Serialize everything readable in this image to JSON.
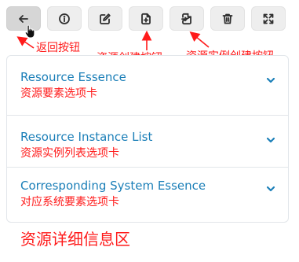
{
  "toolbar": {
    "buttons": [
      {
        "id": "back",
        "icon": "arrow-left-icon"
      },
      {
        "id": "info",
        "icon": "info-icon"
      },
      {
        "id": "edit",
        "icon": "edit-icon"
      },
      {
        "id": "new-resource",
        "icon": "file-plus-icon"
      },
      {
        "id": "new-instance",
        "icon": "file-import-icon"
      },
      {
        "id": "delete",
        "icon": "trash-icon"
      },
      {
        "id": "fullscreen",
        "icon": "expand-icon"
      }
    ]
  },
  "annotations": {
    "back": "返回按钮",
    "create_resource": "资源创建按钮",
    "create_instance": "资源实例创建按钮",
    "detail_area": "资源详细信息区"
  },
  "accordion": {
    "items": [
      {
        "title": "Resource Essence",
        "note": "资源要素选项卡"
      },
      {
        "title": "Resource Instance List",
        "note": "资源实例列表选项卡"
      },
      {
        "title": "Corresponding System Essence",
        "note": "对应系统要素选项卡"
      }
    ]
  },
  "colors": {
    "accent": "#1b7fb8",
    "annotation": "#ff1a1a",
    "button_bg": "#eeeeee"
  }
}
